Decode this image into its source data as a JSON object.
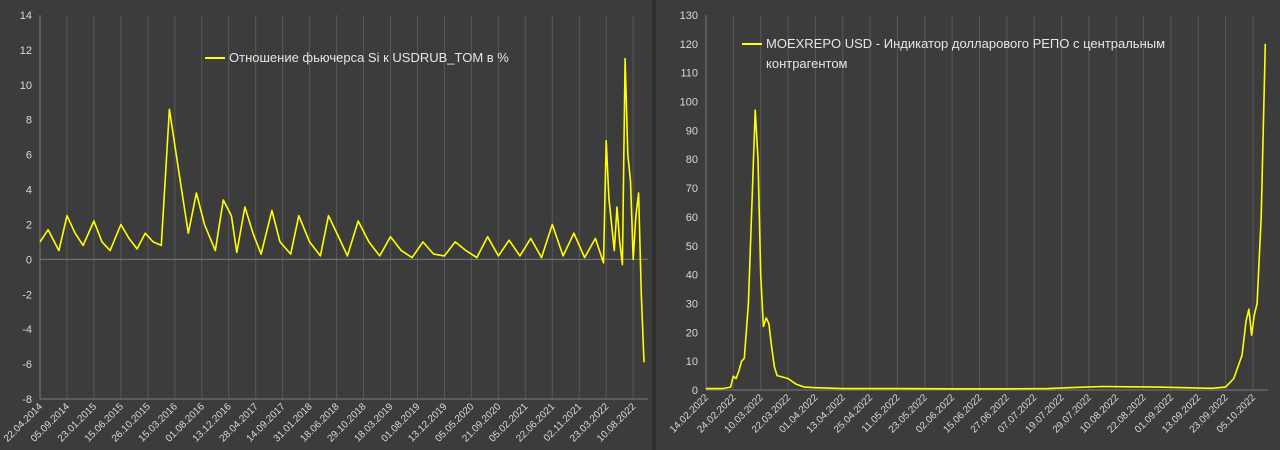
{
  "chart_data": [
    {
      "type": "line",
      "title": "",
      "xlabel": "",
      "ylabel": "",
      "ylim": [
        -8,
        14
      ],
      "yticks": [
        -8,
        -6,
        -4,
        -2,
        0,
        2,
        4,
        6,
        8,
        10,
        12,
        14
      ],
      "x_tick_labels": [
        "22.04.2014",
        "05.09.2014",
        "23.01.2015",
        "15.06.2015",
        "26.10.2015",
        "15.03.2016",
        "01.08.2016",
        "13.12.2016",
        "28.04.2017",
        "14.09.2017",
        "31.01.2018",
        "18.06.2018",
        "29.10.2018",
        "18.03.2019",
        "01.08.2019",
        "13.12.2019",
        "05.05.2020",
        "21.09.2020",
        "05.02.2021",
        "22.06.2021",
        "02.11.2021",
        "23.03.2022",
        "10.08.2022"
      ],
      "grid": "vertical",
      "legend_position": "top-center",
      "series": [
        {
          "name": "Отношение фьючерса Si к USDRUB_TOM в %",
          "color": "#ffff00",
          "x": [
            0,
            0.3,
            0.7,
            1.0,
            1.3,
            1.6,
            2.0,
            2.3,
            2.6,
            3.0,
            3.3,
            3.6,
            3.9,
            4.2,
            4.5,
            4.8,
            5.2,
            5.5,
            5.8,
            6.1,
            6.5,
            6.8,
            7.1,
            7.3,
            7.6,
            7.9,
            8.2,
            8.6,
            8.9,
            9.3,
            9.6,
            10.0,
            10.4,
            10.7,
            11.1,
            11.4,
            11.8,
            12.2,
            12.6,
            13.0,
            13.4,
            13.8,
            14.2,
            14.6,
            15.0,
            15.4,
            15.8,
            16.2,
            16.6,
            17.0,
            17.4,
            17.8,
            18.2,
            18.6,
            19.0,
            19.4,
            19.8,
            20.2,
            20.6,
            20.9,
            21.0,
            21.1,
            21.2,
            21.3,
            21.4,
            21.5,
            21.6,
            21.7,
            21.8,
            21.9,
            22.0,
            22.1,
            22.2,
            22.3,
            22.4
          ],
          "values": [
            1.0,
            1.7,
            0.5,
            2.5,
            1.5,
            0.8,
            2.2,
            1.0,
            0.5,
            2.0,
            1.2,
            0.6,
            1.5,
            1.0,
            0.8,
            8.6,
            4.5,
            1.5,
            3.8,
            2.0,
            0.5,
            3.4,
            2.5,
            0.4,
            3.0,
            1.5,
            0.3,
            2.8,
            1.0,
            0.3,
            2.5,
            1.0,
            0.2,
            2.5,
            1.2,
            0.2,
            2.2,
            1.0,
            0.2,
            1.3,
            0.5,
            0.1,
            1.0,
            0.3,
            0.2,
            1.0,
            0.5,
            0.1,
            1.3,
            0.2,
            1.1,
            0.2,
            1.2,
            0.1,
            2.0,
            0.2,
            1.5,
            0.1,
            1.2,
            -0.2,
            6.8,
            3.5,
            2.0,
            0.5,
            3.0,
            1.0,
            -0.3,
            11.5,
            6.0,
            4.5,
            0.0,
            2.5,
            3.8,
            -2.0,
            -5.9
          ]
        }
      ]
    },
    {
      "type": "line",
      "title": "",
      "xlabel": "",
      "ylabel": "",
      "ylim": [
        0,
        130
      ],
      "yticks": [
        0,
        10,
        20,
        30,
        40,
        50,
        60,
        70,
        80,
        90,
        100,
        110,
        120,
        130
      ],
      "x_tick_labels": [
        "14.02.2022",
        "24.02.2022",
        "10.03.2022",
        "22.03.2022",
        "01.04.2022",
        "13.04.2022",
        "25.04.2022",
        "11.05.2022",
        "23.05.2022",
        "02.06.2022",
        "15.06.2022",
        "27.06.2022",
        "07.07.2022",
        "19.07.2022",
        "29.07.2022",
        "10.08.2022",
        "22.08.2022",
        "01.09.2022",
        "13.09.2022",
        "23.09.2022",
        "05.10.2022"
      ],
      "grid": "vertical",
      "legend_position": "top-center",
      "series": [
        {
          "name": "MOEXREPO USD - Индикатор долларового РЕПО с центральным контрагентом",
          "color": "#ffff00",
          "x": [
            0,
            0.6,
            0.9,
            1.0,
            1.1,
            1.2,
            1.3,
            1.4,
            1.55,
            1.7,
            1.8,
            1.9,
            2.0,
            2.1,
            2.2,
            2.3,
            2.4,
            2.5,
            2.6,
            2.8,
            3.0,
            3.3,
            3.6,
            4.0,
            5.0,
            7.0,
            9.0,
            11.0,
            12.5,
            13.5,
            14.5,
            15.5,
            16.5,
            17.5,
            18.5,
            19.0,
            19.3,
            19.6,
            19.75,
            19.85,
            19.95,
            20.05,
            20.15,
            20.3,
            20.45
          ],
          "values": [
            0.5,
            0.5,
            1.0,
            4.8,
            4.0,
            6.5,
            10.0,
            11.0,
            30.0,
            70.0,
            97.0,
            80.0,
            40.0,
            22.0,
            25.0,
            23.0,
            15.0,
            8.0,
            5.0,
            4.5,
            4.0,
            2.0,
            1.0,
            0.8,
            0.5,
            0.5,
            0.4,
            0.4,
            0.5,
            0.9,
            1.2,
            1.1,
            1.0,
            0.8,
            0.6,
            1.0,
            4.0,
            12.0,
            24.0,
            28.0,
            19.0,
            26.0,
            30.0,
            60.0,
            120.0
          ]
        }
      ]
    }
  ]
}
